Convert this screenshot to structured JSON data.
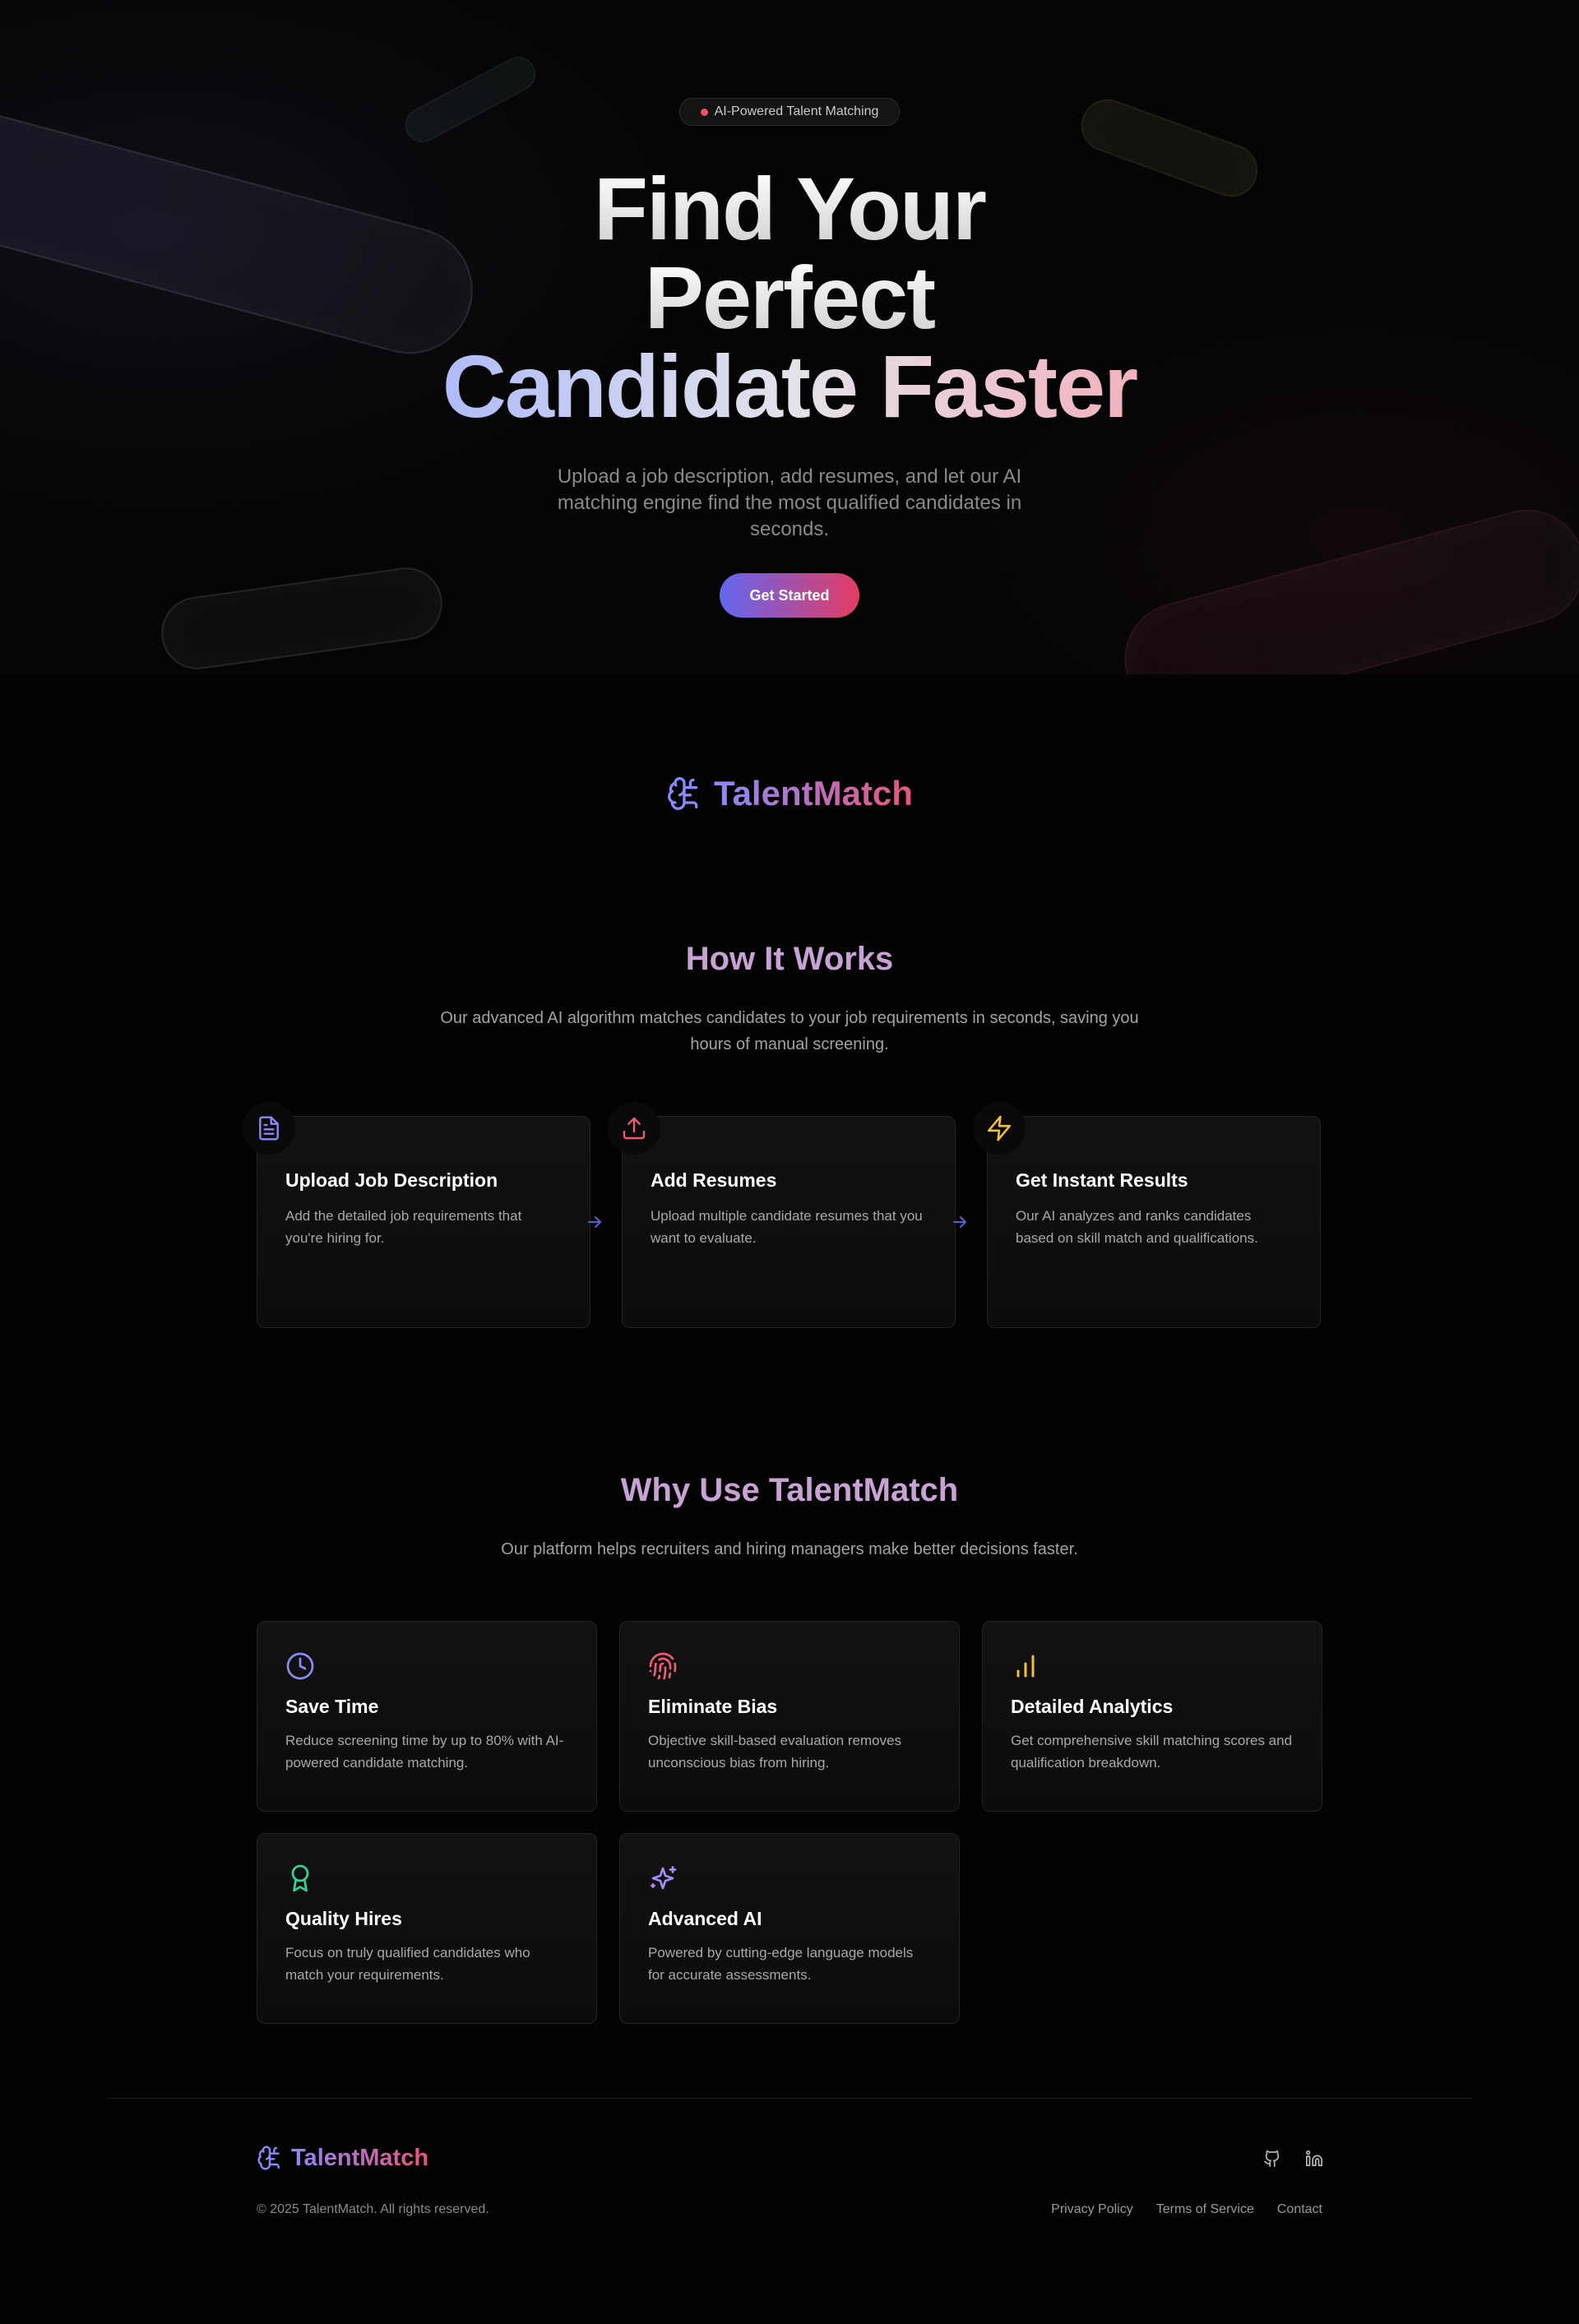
{
  "hero": {
    "badge_text": "AI-Powered Talent Matching",
    "title_line1": "Find Your",
    "title_line2": "Perfect",
    "title_line3a": "Candidate",
    "title_line3b": "Faster",
    "subtitle": "Upload a job description, add resumes, and let our AI matching engine find the most qualified candidates in seconds.",
    "cta_label": "Get Started",
    "cta_gradient": [
      "#6366f1",
      "#e43d62"
    ]
  },
  "brand": {
    "name": "TalentMatch",
    "icon": "brain-icon",
    "gradient": [
      "#8b8af8",
      "#e8557a"
    ]
  },
  "how_it_works": {
    "title": "How It Works",
    "subtitle": "Our advanced AI algorithm matches candidates to your job requirements in seconds, saving you hours of manual screening.",
    "steps": [
      {
        "title": "Upload Job Description",
        "description": "Add the detailed job requirements that you're hiring for.",
        "icon": "document-icon",
        "color": "#8b8af8"
      },
      {
        "title": "Add Resumes",
        "description": "Upload multiple candidate resumes that you want to evaluate.",
        "icon": "upload-icon",
        "color": "#f05a75"
      },
      {
        "title": "Get Instant Results",
        "description": "Our AI analyzes and ranks candidates based on skill match and qualifications.",
        "icon": "lightning-icon",
        "color": "#f5c038"
      }
    ]
  },
  "why_use": {
    "title": "Why Use TalentMatch",
    "subtitle": "Our platform helps recruiters and hiring managers make better decisions faster.",
    "features": [
      {
        "title": "Save Time",
        "description": "Reduce screening time by up to 80% with AI-powered candidate matching.",
        "icon": "clock-icon",
        "color": "#8b8af8"
      },
      {
        "title": "Eliminate Bias",
        "description": "Objective skill-based evaluation removes unconscious bias from hiring.",
        "icon": "fingerprint-icon",
        "color": "#f05a75"
      },
      {
        "title": "Detailed Analytics",
        "description": "Get comprehensive skill matching scores and qualification breakdown.",
        "icon": "bar-chart-icon",
        "color": "#f5c038"
      },
      {
        "title": "Quality Hires",
        "description": "Focus on truly qualified candidates who match your requirements.",
        "icon": "award-icon",
        "color": "#34d399"
      },
      {
        "title": "Advanced AI",
        "description": "Powered by cutting-edge language models for accurate assessments.",
        "icon": "sparkles-icon",
        "color": "#a78bfa"
      }
    ]
  },
  "footer": {
    "brand": "TalentMatch",
    "copyright": "© 2025 TalentMatch. All rights reserved.",
    "links": [
      "Privacy Policy",
      "Terms of Service",
      "Contact"
    ],
    "social": [
      "github-icon",
      "linkedin-icon"
    ]
  }
}
